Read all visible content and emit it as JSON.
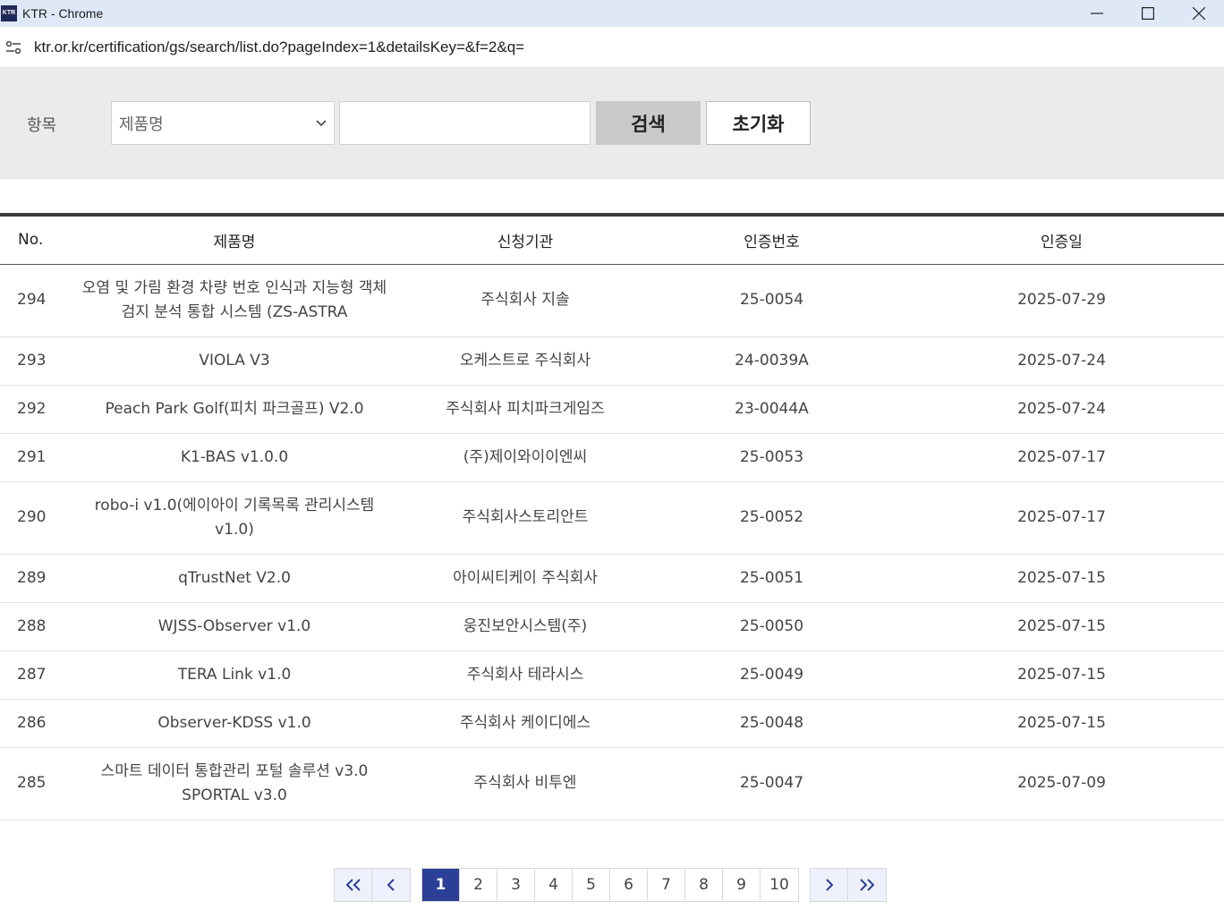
{
  "browser": {
    "window_title": "KTR - Chrome",
    "favicon_text": "KTR",
    "url": "ktr.or.kr/certification/gs/search/list.do?pageIndex=1&detailsKey=&f=2&q="
  },
  "search": {
    "label": "항목",
    "select_value": "제품명",
    "input_value": "",
    "search_button": "검색",
    "reset_button": "초기화"
  },
  "table": {
    "headers": [
      "No.",
      "제품명",
      "신청기관",
      "인증번호",
      "인증일"
    ],
    "rows": [
      {
        "no": "294",
        "name": "오염 및 가림 환경 차량 번호 인식과 지능형 객체 검지 분석 통합 시스템 (ZS-ASTRA",
        "org": "주식회사 지솔",
        "cert": "25-0054",
        "date": "2025-07-29"
      },
      {
        "no": "293",
        "name": "VIOLA V3",
        "org": "오케스트로 주식회사",
        "cert": "24-0039A",
        "date": "2025-07-24"
      },
      {
        "no": "292",
        "name": "Peach Park Golf(피치 파크골프) V2.0",
        "org": "주식회사 피치파크게임즈",
        "cert": "23-0044A",
        "date": "2025-07-24"
      },
      {
        "no": "291",
        "name": "K1-BAS v1.0.0",
        "org": "(주)제이와이이엔씨",
        "cert": "25-0053",
        "date": "2025-07-17"
      },
      {
        "no": "290",
        "name": "robo-i v1.0(에이아이 기록목록 관리시스템 v1.0)",
        "org": "주식회사스토리안트",
        "cert": "25-0052",
        "date": "2025-07-17"
      },
      {
        "no": "289",
        "name": "qTrustNet V2.0",
        "org": "아이씨티케이 주식회사",
        "cert": "25-0051",
        "date": "2025-07-15"
      },
      {
        "no": "288",
        "name": "WJSS-Observer v1.0",
        "org": "웅진보안시스템(주)",
        "cert": "25-0050",
        "date": "2025-07-15"
      },
      {
        "no": "287",
        "name": "TERA Link v1.0",
        "org": "주식회사 테라시스",
        "cert": "25-0049",
        "date": "2025-07-15"
      },
      {
        "no": "286",
        "name": "Observer-KDSS v1.0",
        "org": "주식회사 케이디에스",
        "cert": "25-0048",
        "date": "2025-07-15"
      },
      {
        "no": "285",
        "name": "스마트 데이터 통합관리 포털 솔루션 v3.0 SPORTAL v3.0",
        "org": "주식회사 비투엔",
        "cert": "25-0047",
        "date": "2025-07-09"
      }
    ]
  },
  "pagination": {
    "pages": [
      "1",
      "2",
      "3",
      "4",
      "5",
      "6",
      "7",
      "8",
      "9",
      "10"
    ],
    "current": "1"
  },
  "colors": {
    "active_page": "#2a3f95",
    "search_panel_bg": "#ebebeb",
    "titlebar_bg": "#dfe8f6"
  }
}
